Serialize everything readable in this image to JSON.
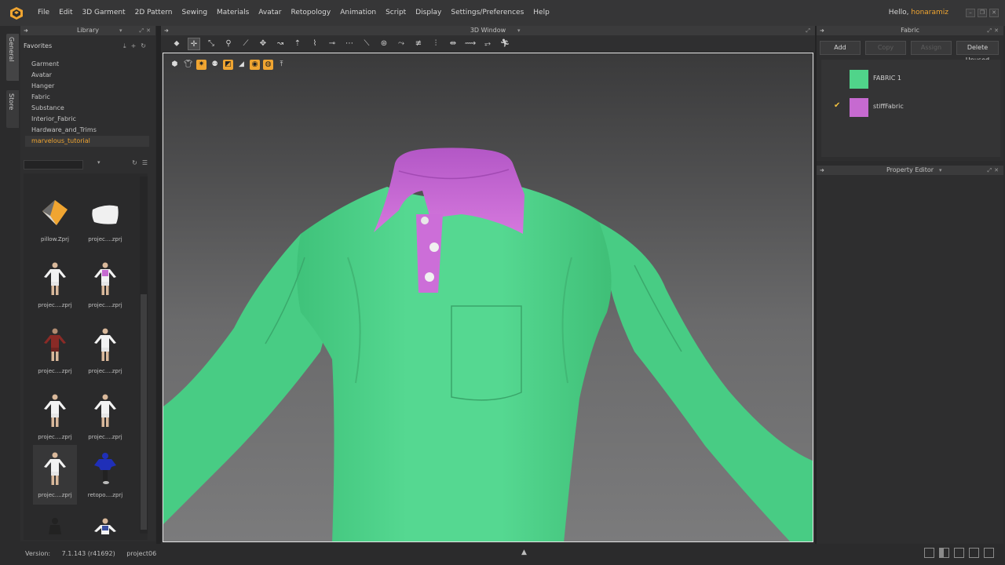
{
  "menubar": {
    "items": [
      "File",
      "Edit",
      "3D Garment",
      "2D Pattern",
      "Sewing",
      "Materials",
      "Avatar",
      "Retopology",
      "Animation",
      "Script",
      "Display",
      "Settings/Preferences",
      "Help"
    ],
    "greeting": "Hello,",
    "username": "honaramiz"
  },
  "sidetabs": {
    "general": "General",
    "store": "Store"
  },
  "library": {
    "title": "Library",
    "favorites_label": "Favorites",
    "favorites": [
      "Garment",
      "Avatar",
      "Hanger",
      "Fabric",
      "Substance",
      "Interior_Fabric",
      "Hardware_and_Trims",
      "marvelous_tutorial"
    ],
    "selected_favorite": "marvelous_tutorial",
    "files": [
      "pillow.Zprj",
      "projec....zprj",
      "projec....zprj",
      "projec....zprj",
      "projec....zprj",
      "projec....zprj",
      "projec....zprj",
      "projec....zprj",
      "projec....zprj",
      "retopo....zprj"
    ]
  },
  "window3d": {
    "title": "3D Window"
  },
  "fabric": {
    "title": "Fabric",
    "buttons": {
      "add": "Add",
      "copy": "Copy",
      "assign": "Assign",
      "delete_unused": "Delete Unused"
    },
    "items": [
      {
        "name": "FABRIC 1",
        "color": "#50d48a",
        "checked": false
      },
      {
        "name": "stiffFabric",
        "color": "#c66ad0",
        "checked": true
      }
    ]
  },
  "property_editor": {
    "title": "Property Editor"
  },
  "status": {
    "version_label": "Version:",
    "version": "7.1.143 (r41692)",
    "project": "project06"
  },
  "colors": {
    "accent": "#f0a531",
    "shirt": "#50d48a",
    "collar": "#c66ad0"
  }
}
